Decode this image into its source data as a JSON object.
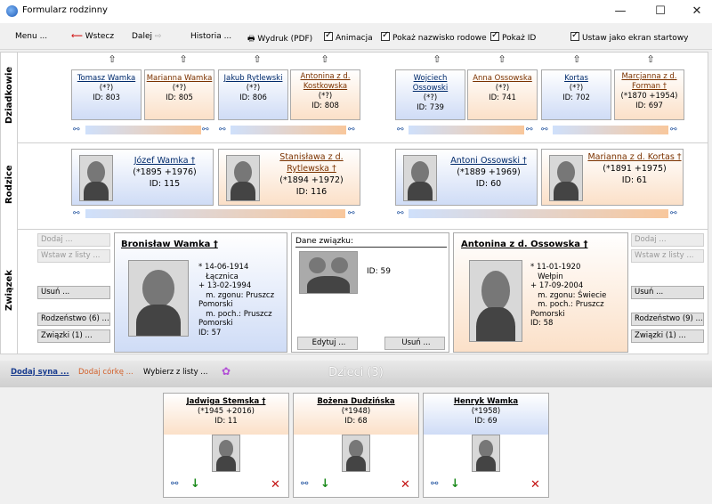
{
  "window": {
    "title": "Formularz rodzinny"
  },
  "toolbar": {
    "menu": "Menu ...",
    "back": "Wstecz",
    "forward": "Dalej",
    "history": "Historia ...",
    "print": "Wydruk (PDF)",
    "animation": "Animacja",
    "show_family_name": "Pokaż nazwisko rodowe",
    "show_id": "Pokaż ID",
    "start_screen": "Ustaw jako ekran startowy"
  },
  "labels": {
    "grandparents": "Dziadkowie",
    "parents": "Rodzice",
    "union": "Związek"
  },
  "grandparents": [
    {
      "name": "Tomasz Wamka",
      "dates": "(*?)",
      "id": "ID: 803",
      "sex": "male"
    },
    {
      "name": "Marianna Wamka",
      "dates": "(*?)",
      "id": "ID: 805",
      "sex": "female"
    },
    {
      "name": "Jakub Rytlewski",
      "dates": "(*?)",
      "id": "ID: 806",
      "sex": "male"
    },
    {
      "name": "Antonina z d. Kostkowska",
      "dates": "(*?)",
      "id": "ID: 808",
      "sex": "female"
    },
    {
      "name": "Wojciech Ossowski",
      "dates": "(*?)",
      "id": "ID: 739",
      "sex": "male"
    },
    {
      "name": "Anna Ossowska",
      "dates": "(*?)",
      "id": "ID: 741",
      "sex": "female"
    },
    {
      "name": "Kortas",
      "dates": "(*?)",
      "id": "ID: 702",
      "sex": "male"
    },
    {
      "name": "Marcjanna z d. Forman †",
      "dates": "(*1870 +1954)",
      "id": "ID: 697",
      "sex": "female"
    }
  ],
  "parents": [
    {
      "name": "Józef Wamka †",
      "dates": "(*1895 +1976)",
      "id": "ID: 115",
      "sex": "male"
    },
    {
      "name": "Stanisława z d. Rytlewska †",
      "dates": "(*1894 +1972)",
      "id": "ID: 116",
      "sex": "female"
    },
    {
      "name": "Antoni Ossowski †",
      "dates": "(*1889 +1969)",
      "id": "ID: 60",
      "sex": "male"
    },
    {
      "name": "Marianna z d. Kortas †",
      "dates": "(*1891 +1975)",
      "id": "ID: 61",
      "sex": "female"
    }
  ],
  "union": {
    "left_buttons": [
      "Dodaj ...",
      "Wstaw z listy ...",
      "Usuń ...",
      "Rodzeństwo (6) ...",
      "Związki (1) ..."
    ],
    "right_buttons": [
      "Dodaj ...",
      "Wstaw z listy ...",
      "Usuń ...",
      "Rodzeństwo (9) ...",
      "Związki (1) ..."
    ],
    "husband": {
      "name": "Bronisław Wamka †",
      "details": "* 14-06-1914\n   Łącznica\n+ 13-02-1994\n   m. zgonu: Pruszcz\nPomorski\n   m. poch.: Pruszcz\nPomorski\nID: 57"
    },
    "wife": {
      "name": "Antonina z d. Ossowska †",
      "details": "* 11-01-1920\n   Wełpin\n+ 17-09-2004\n   m. zgonu: Świecie\n   m. poch.: Pruszcz\nPomorski\nID: 58"
    },
    "marriage": {
      "title": "Dane związku:",
      "id": "ID: 59",
      "edit": "Edytuj ...",
      "remove": "Usuń ..."
    }
  },
  "children_bar": {
    "title": "Dzieci (3)",
    "add_son": "Dodaj syna ...",
    "add_daughter": "Dodaj córkę ...",
    "choose": "Wybierz z listy ..."
  },
  "children": [
    {
      "name": "Jadwiga Stemska †",
      "dates": "(*1945 +2016)",
      "id": "ID: 11",
      "sex": "female"
    },
    {
      "name": "Bożena Dudzińska",
      "dates": "(*1948)",
      "id": "ID: 68",
      "sex": "female"
    },
    {
      "name": "Henryk Wamka",
      "dates": "(*1958)",
      "id": "ID: 69",
      "sex": "male"
    }
  ],
  "colors": {
    "male": "#cfdcf6",
    "female": "#fbe0c8",
    "remove": "#c41414",
    "add_son": "#1a3d8f",
    "add_daughter": "#d2602a"
  }
}
